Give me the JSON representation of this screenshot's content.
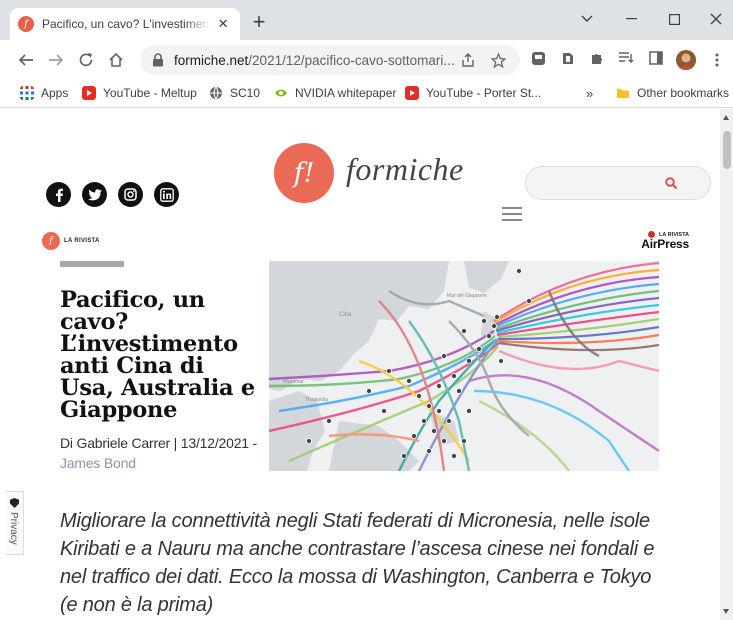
{
  "browser": {
    "tab_title": "Pacifico, un cavo? L'investimento anti Cina di Usa, Australia e Giappone",
    "tab_close": "✕",
    "new_tab": "+",
    "url_host": "formiche.net",
    "url_path": "/2021/12/pacifico-cavo-sottomari...",
    "bookmarks": [
      {
        "label": "Apps",
        "icon": "apps-grid-icon"
      },
      {
        "label": "YouTube - Meltup",
        "icon": "youtube-icon"
      },
      {
        "label": "SC10",
        "icon": "globe-icon"
      },
      {
        "label": "NVIDIA whitepaper",
        "icon": "nvidia-icon"
      },
      {
        "label": "YouTube - Porter St...",
        "icon": "youtube-icon"
      }
    ],
    "bookmarks_overflow": "»",
    "other_bookmarks": "Other bookmarks"
  },
  "site": {
    "logo_mark": "f!",
    "logo_word": "formiche",
    "rivista_label": "LA RIVISTA",
    "airpress_label": "LA RIVISTA",
    "airpress_name": "AirPress",
    "privacy_label": "Privacy"
  },
  "article": {
    "headline": "Pacifico, un cavo? L’investimento anti Cina di Usa, Australia e Giappone",
    "byline_prefix": "Di Gabriele Carrer | 13/12/2021 -",
    "byline_author": "James Bond",
    "lead": "Migliorare la connettività negli Stati federati di Micronesia, nelle isole Kiribati e a Nauru ma anche contrastare l’ascesa cinese nei fondali e nel traffico dei dati. Ecco la mossa di Washington, Canberra e Tokyo (e non è la prima)",
    "map_labels": [
      "Cina",
      "Myanmar",
      "Thailandia",
      "Mar del Giappone"
    ]
  },
  "colors": {
    "brand": "#ea6a55",
    "airpress_dot": "#c0392b",
    "author_link": "#8a94a6",
    "search_icon": "#d9534f"
  }
}
